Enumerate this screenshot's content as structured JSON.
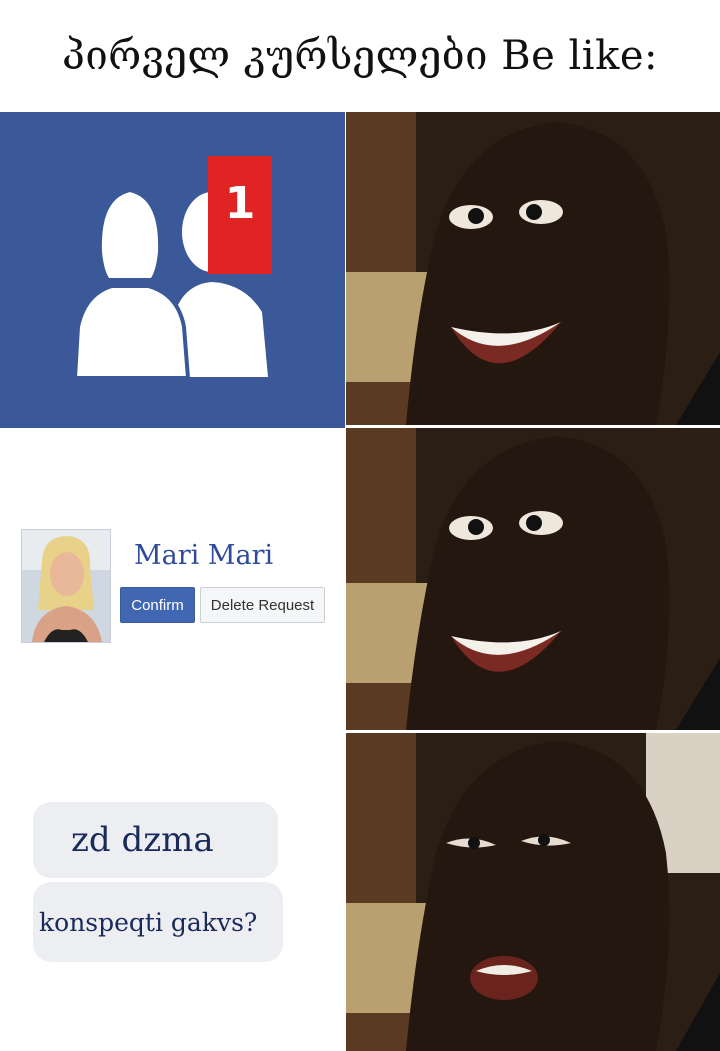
{
  "title": "პირველ კურსელები Be like:",
  "notification": {
    "count": "1"
  },
  "friend_request": {
    "name": "Mari Mari",
    "confirm_label": "Confirm",
    "delete_label": "Delete Request"
  },
  "messages": [
    {
      "text": "zd dzma"
    },
    {
      "text": "konspeqti gakvs?"
    }
  ],
  "colors": {
    "facebook_blue": "#3b5998",
    "badge_red": "#e02424",
    "confirm_blue": "#4267b2",
    "name_blue": "#2e4a9a"
  },
  "icons": [
    "friends-silhouette-icon",
    "notification-badge"
  ]
}
